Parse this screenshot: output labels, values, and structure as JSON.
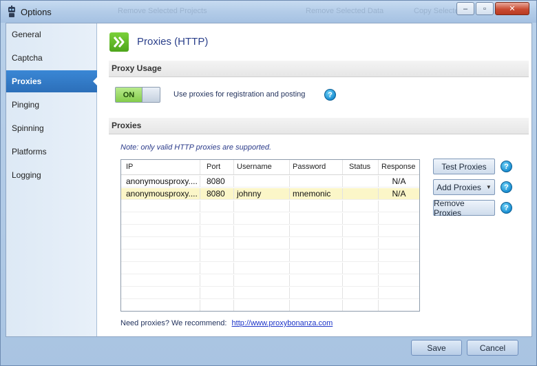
{
  "window": {
    "title": "Options",
    "ghost_toolbar": [
      "Remove Selected Projects",
      "Remove Selected Data",
      "Copy Selected"
    ]
  },
  "window_controls": {
    "minimize": "‒",
    "maximize": "▫",
    "close": "✕"
  },
  "sidebar": {
    "items": [
      {
        "label": "General"
      },
      {
        "label": "Captcha"
      },
      {
        "label": "Proxies"
      },
      {
        "label": "Pinging"
      },
      {
        "label": "Spinning"
      },
      {
        "label": "Platforms"
      },
      {
        "label": "Logging"
      }
    ],
    "active_index": 2
  },
  "page": {
    "title": "Proxies (HTTP)",
    "icon": "double-chevron-right-icon"
  },
  "proxy_usage": {
    "section_title": "Proxy Usage",
    "toggle_state": "ON",
    "label": "Use proxies for registration and posting",
    "help": "?"
  },
  "proxies": {
    "section_title": "Proxies",
    "note": "Note: only valid HTTP proxies are supported.",
    "columns": [
      "IP",
      "Port",
      "Username",
      "Password",
      "Status",
      "Response"
    ],
    "rows": [
      {
        "ip": "anonymousproxy....",
        "port": "8080",
        "username": "",
        "password": "",
        "status": "",
        "response": "N/A",
        "selected": false
      },
      {
        "ip": "anonymousproxy....",
        "port": "8080",
        "username": "johnny",
        "password": "mnemonic",
        "status": "",
        "response": "N/A",
        "selected": true
      }
    ],
    "empty_rows": 9,
    "buttons": {
      "test": "Test Proxies",
      "add": "Add Proxies",
      "remove": "Remove Proxies"
    },
    "help": "?",
    "recommend_text": "Need proxies? We recommend:",
    "recommend_link": "http://www.proxybonanza.com"
  },
  "footer": {
    "save": "Save",
    "cancel": "Cancel"
  },
  "colors": {
    "accent": "#2c6fb9",
    "toggle_on": "#84cc4b",
    "selected_row": "#fbf6c8",
    "help_icon": "#1b8fd2"
  }
}
